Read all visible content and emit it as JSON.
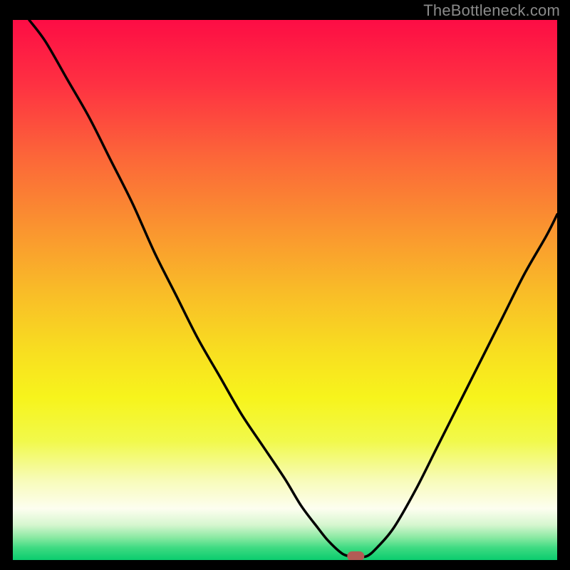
{
  "watermark": "TheBottleneck.com",
  "chart_data": {
    "type": "line",
    "title": "",
    "xlabel": "",
    "ylabel": "",
    "xlim": [
      0,
      100
    ],
    "ylim": [
      0,
      100
    ],
    "x": [
      3,
      6,
      10,
      14,
      18,
      22,
      26,
      30,
      34,
      38,
      42,
      46,
      50,
      53,
      56,
      58,
      60.5,
      62,
      63,
      65,
      67,
      70,
      74,
      78,
      82,
      86,
      90,
      94,
      98,
      100
    ],
    "values": [
      100,
      96,
      89,
      82,
      74,
      66,
      57,
      49,
      41,
      34,
      27,
      21,
      15,
      10,
      6,
      3.5,
      1.2,
      0.7,
      0.7,
      0.7,
      2.4,
      6,
      13,
      21,
      29,
      37,
      45,
      53,
      60,
      64
    ],
    "marker": {
      "x": 63,
      "y": 0.7,
      "color": "#b25b55",
      "shape": "pill"
    },
    "gradient_stops": [
      {
        "offset": 0.0,
        "color": "#fd0d45"
      },
      {
        "offset": 0.12,
        "color": "#fe3142"
      },
      {
        "offset": 0.25,
        "color": "#fc6539"
      },
      {
        "offset": 0.38,
        "color": "#fa9230"
      },
      {
        "offset": 0.5,
        "color": "#f9bb28"
      },
      {
        "offset": 0.62,
        "color": "#f8e020"
      },
      {
        "offset": 0.7,
        "color": "#f7f41c"
      },
      {
        "offset": 0.78,
        "color": "#f1f94b"
      },
      {
        "offset": 0.85,
        "color": "#f7fbb6"
      },
      {
        "offset": 0.905,
        "color": "#fdfef0"
      },
      {
        "offset": 0.935,
        "color": "#d6f6cf"
      },
      {
        "offset": 0.958,
        "color": "#8be9a3"
      },
      {
        "offset": 0.978,
        "color": "#3cda81"
      },
      {
        "offset": 1.0,
        "color": "#0bcc6e"
      }
    ]
  }
}
